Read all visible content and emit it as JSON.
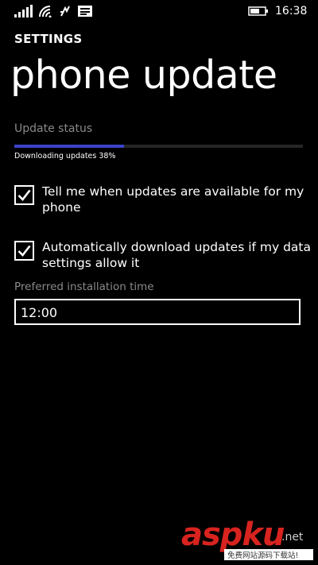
{
  "status_bar": {
    "time": "16:38",
    "icons": [
      "signal-icon",
      "wifi-icon",
      "sim-icon",
      "message-icon",
      "battery-icon"
    ]
  },
  "header": {
    "section": "SETTINGS",
    "title": "phone update"
  },
  "update_status": {
    "heading": "Update status",
    "progress": 0.38,
    "progress_text": "Downloading updates 38%"
  },
  "options": [
    {
      "label": "Tell me when updates are available for my phone",
      "checked": true
    },
    {
      "label": "Automatically download updates if my data settings allow it",
      "checked": true
    }
  ],
  "install_time": {
    "label": "Preferred installation time",
    "value": "12:00"
  },
  "watermark": {
    "brand": "aspku",
    "suffix": ".net",
    "tagline": "免费网站源码下载站!"
  },
  "colors": {
    "accent": "#3a43c8",
    "background": "#000000",
    "subtle_text": "#8a8a8a"
  }
}
